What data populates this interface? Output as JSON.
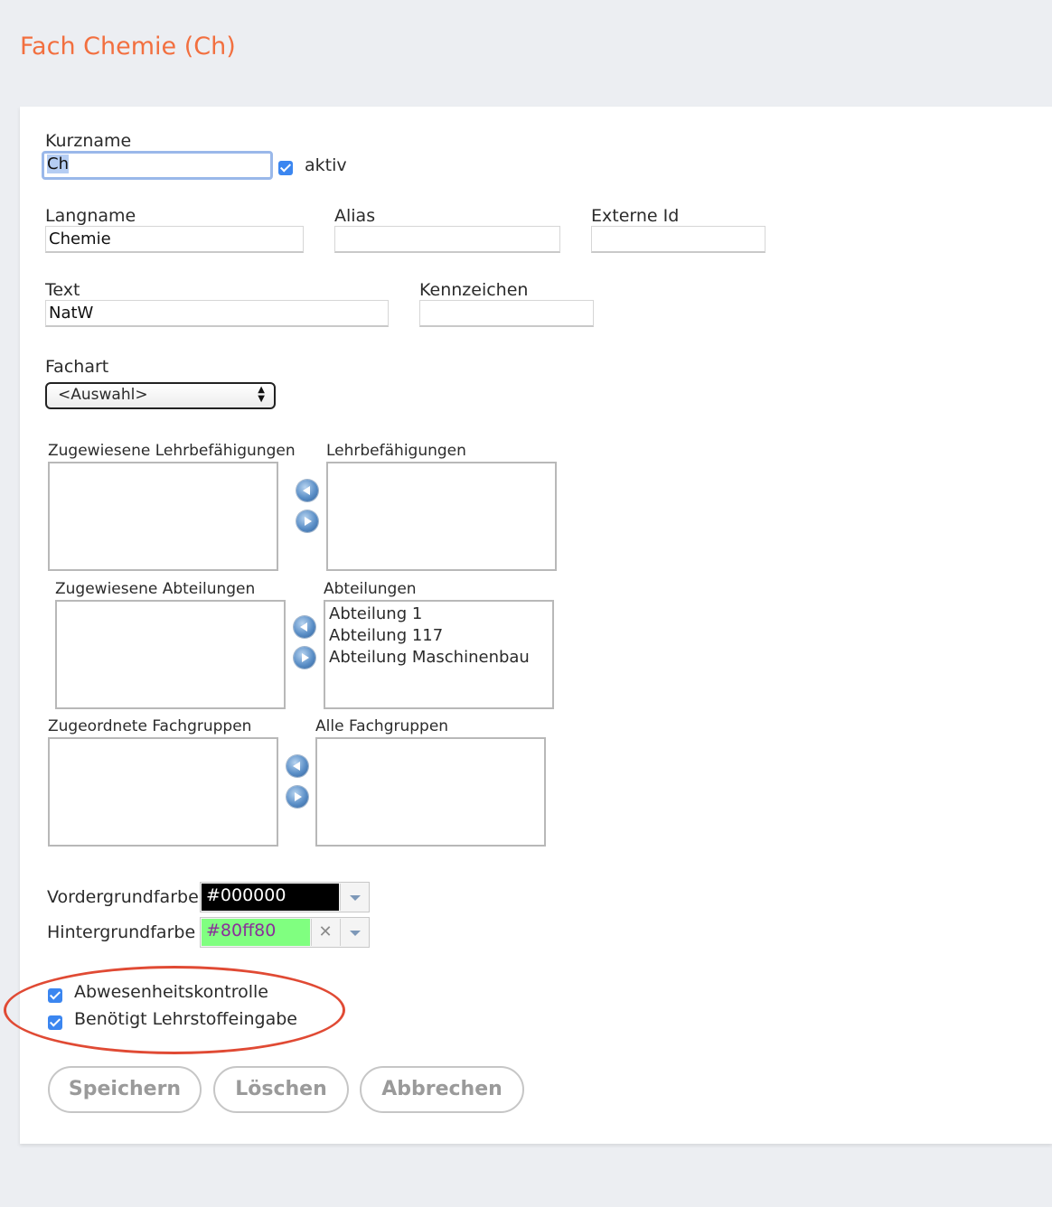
{
  "page": {
    "title": "Fach Chemie (Ch)"
  },
  "form": {
    "kurzname_label": "Kurzname",
    "kurzname_value": "Ch",
    "aktiv_label": "aktiv",
    "langname_label": "Langname",
    "langname_value": "Chemie",
    "alias_label": "Alias",
    "alias_value": "",
    "externe_id_label": "Externe Id",
    "externe_id_value": "",
    "text_label": "Text",
    "text_value": "NatW",
    "kennzeichen_label": "Kennzeichen",
    "kennzeichen_value": "",
    "fachart_label": "Fachart",
    "fachart_value": "<Auswahl>"
  },
  "lists": {
    "zugewiesene_lehrbef_label": "Zugewiesene Lehrbefähigungen",
    "lehrbef_label": "Lehrbefähigungen",
    "zugewiesene_abteilungen_label": "Zugewiesene Abteilungen",
    "abteilungen_label": "Abteilungen",
    "abteilungen_items": [
      "Abteilung 1",
      "Abteilung 117",
      "Abteilung Maschinenbau"
    ],
    "zugeordnete_fachgruppen_label": "Zugeordnete Fachgruppen",
    "alle_fachgruppen_label": "Alle Fachgruppen"
  },
  "colors": {
    "vordergrund_label": "Vordergrundfarbe",
    "vordergrund_value": "#000000",
    "vordergrund_swatch": "#000000",
    "hintergrund_label": "Hintergrundfarbe",
    "hintergrund_value": "#80ff80",
    "hintergrund_swatch": "#80ff80"
  },
  "options": {
    "abwesenheit_label": "Abwesenheitskontrolle",
    "lehrstoff_label": "Benötigt Lehrstoffeingabe"
  },
  "buttons": {
    "save": "Speichern",
    "delete": "Löschen",
    "cancel": "Abbrechen"
  },
  "theme": {
    "accent": "#f26f3f",
    "checkbox": "#3b86f0",
    "annotation": "#e04a34"
  }
}
